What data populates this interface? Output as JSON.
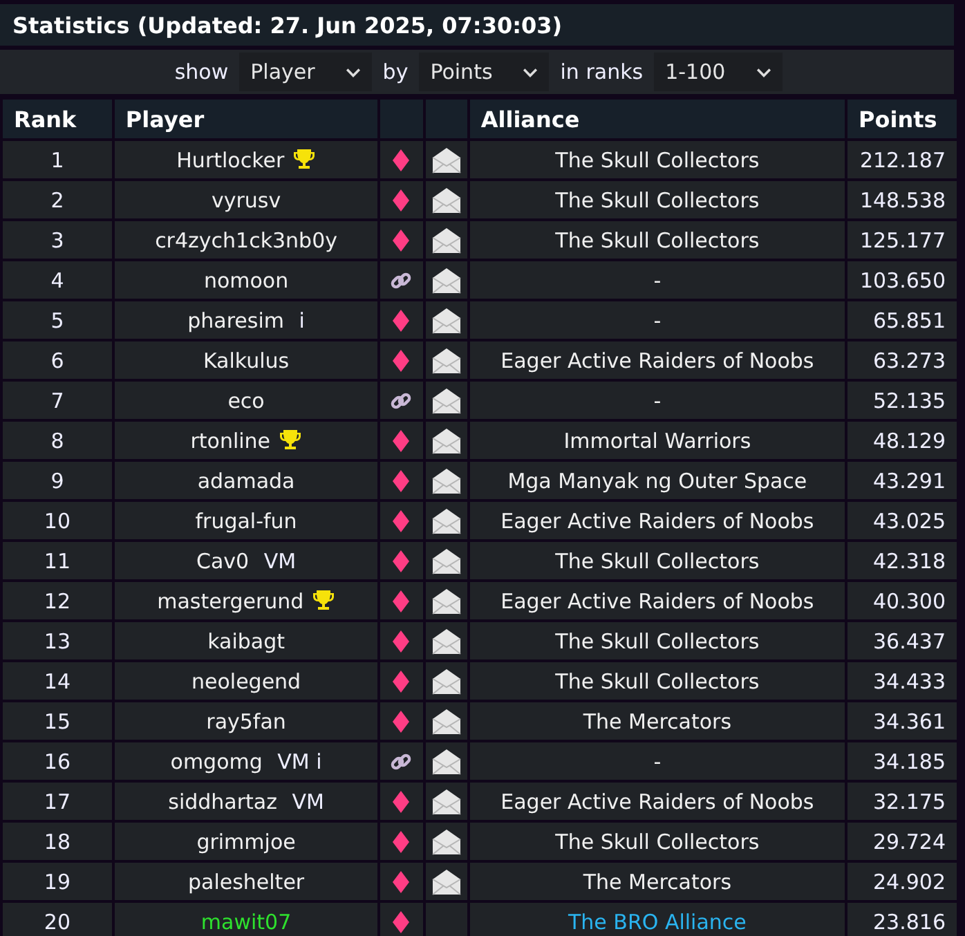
{
  "title": "Statistics (Updated: 27. Jun 2025, 07:30:03)",
  "filter": [
    {
      "kind": "label",
      "text": "show"
    },
    {
      "kind": "select",
      "text": "Player"
    },
    {
      "kind": "label",
      "text": "by"
    },
    {
      "kind": "select",
      "text": "Points"
    },
    {
      "kind": "label",
      "text": "in ranks"
    },
    {
      "kind": "select",
      "text": "1-100"
    }
  ],
  "columns": [
    "Rank",
    "Player",
    "Alliance",
    "Points"
  ],
  "rows": [
    {
      "rank": "1",
      "player": "Hurtlocker",
      "trophy": true,
      "linked": false,
      "message": true,
      "alliance": "The Skull Collectors",
      "points": "212.187",
      "own": false
    },
    {
      "rank": "2",
      "player": "vyrusv",
      "trophy": false,
      "linked": false,
      "message": true,
      "alliance": "The Skull Collectors",
      "points": "148.538",
      "own": false
    },
    {
      "rank": "3",
      "player": "cr4zych1ck3nb0y",
      "trophy": false,
      "linked": false,
      "message": true,
      "alliance": "The Skull Collectors",
      "points": "125.177",
      "own": false
    },
    {
      "rank": "4",
      "player": "nomoon",
      "trophy": false,
      "linked": true,
      "message": true,
      "alliance": "-",
      "points": "103.650",
      "own": false
    },
    {
      "rank": "5",
      "player": "pharesim",
      "tags": "i",
      "trophy": false,
      "linked": false,
      "message": true,
      "alliance": "-",
      "points": "65.851",
      "own": false
    },
    {
      "rank": "6",
      "player": "Kalkulus",
      "trophy": false,
      "linked": false,
      "message": true,
      "alliance": "Eager Active Raiders of Noobs",
      "points": "63.273",
      "own": false
    },
    {
      "rank": "7",
      "player": "eco",
      "trophy": false,
      "linked": true,
      "message": true,
      "alliance": "-",
      "points": "52.135",
      "own": false
    },
    {
      "rank": "8",
      "player": "rtonline",
      "trophy": true,
      "linked": false,
      "message": true,
      "alliance": "Immortal Warriors",
      "points": "48.129",
      "own": false
    },
    {
      "rank": "9",
      "player": "adamada",
      "trophy": false,
      "linked": false,
      "message": true,
      "alliance": "Mga Manyak ng Outer Space",
      "points": "43.291",
      "own": false
    },
    {
      "rank": "10",
      "player": "frugal-fun",
      "trophy": false,
      "linked": false,
      "message": true,
      "alliance": "Eager Active Raiders of Noobs",
      "points": "43.025",
      "own": false
    },
    {
      "rank": "11",
      "player": "Cav0",
      "tags": "VM",
      "trophy": false,
      "linked": false,
      "message": true,
      "alliance": "The Skull Collectors",
      "points": "42.318",
      "own": false
    },
    {
      "rank": "12",
      "player": "mastergerund",
      "trophy": true,
      "linked": false,
      "message": true,
      "alliance": "Eager Active Raiders of Noobs",
      "points": "40.300",
      "own": false
    },
    {
      "rank": "13",
      "player": "kaibagt",
      "trophy": false,
      "linked": false,
      "message": true,
      "alliance": "The Skull Collectors",
      "points": "36.437",
      "own": false
    },
    {
      "rank": "14",
      "player": "neolegend",
      "trophy": false,
      "linked": false,
      "message": true,
      "alliance": "The Skull Collectors",
      "points": "34.433",
      "own": false
    },
    {
      "rank": "15",
      "player": "ray5fan",
      "trophy": false,
      "linked": false,
      "message": true,
      "alliance": "The Mercators",
      "points": "34.361",
      "own": false
    },
    {
      "rank": "16",
      "player": "omgomg",
      "tags": "VM i",
      "trophy": false,
      "linked": true,
      "message": true,
      "alliance": "-",
      "points": "34.185",
      "own": false
    },
    {
      "rank": "17",
      "player": "siddhartaz",
      "tags": "VM",
      "trophy": false,
      "linked": false,
      "message": true,
      "alliance": "Eager Active Raiders of Noobs",
      "points": "32.175",
      "own": false
    },
    {
      "rank": "18",
      "player": "grimmjoe",
      "trophy": false,
      "linked": false,
      "message": true,
      "alliance": "The Skull Collectors",
      "points": "29.724",
      "own": false
    },
    {
      "rank": "19",
      "player": "paleshelter",
      "trophy": false,
      "linked": false,
      "message": true,
      "alliance": "The Mercators",
      "points": "24.902",
      "own": false
    },
    {
      "rank": "20",
      "player": "mawit07",
      "trophy": false,
      "linked": false,
      "message": false,
      "alliance": "The BRO Alliance",
      "points": "23.816",
      "own": true
    }
  ]
}
